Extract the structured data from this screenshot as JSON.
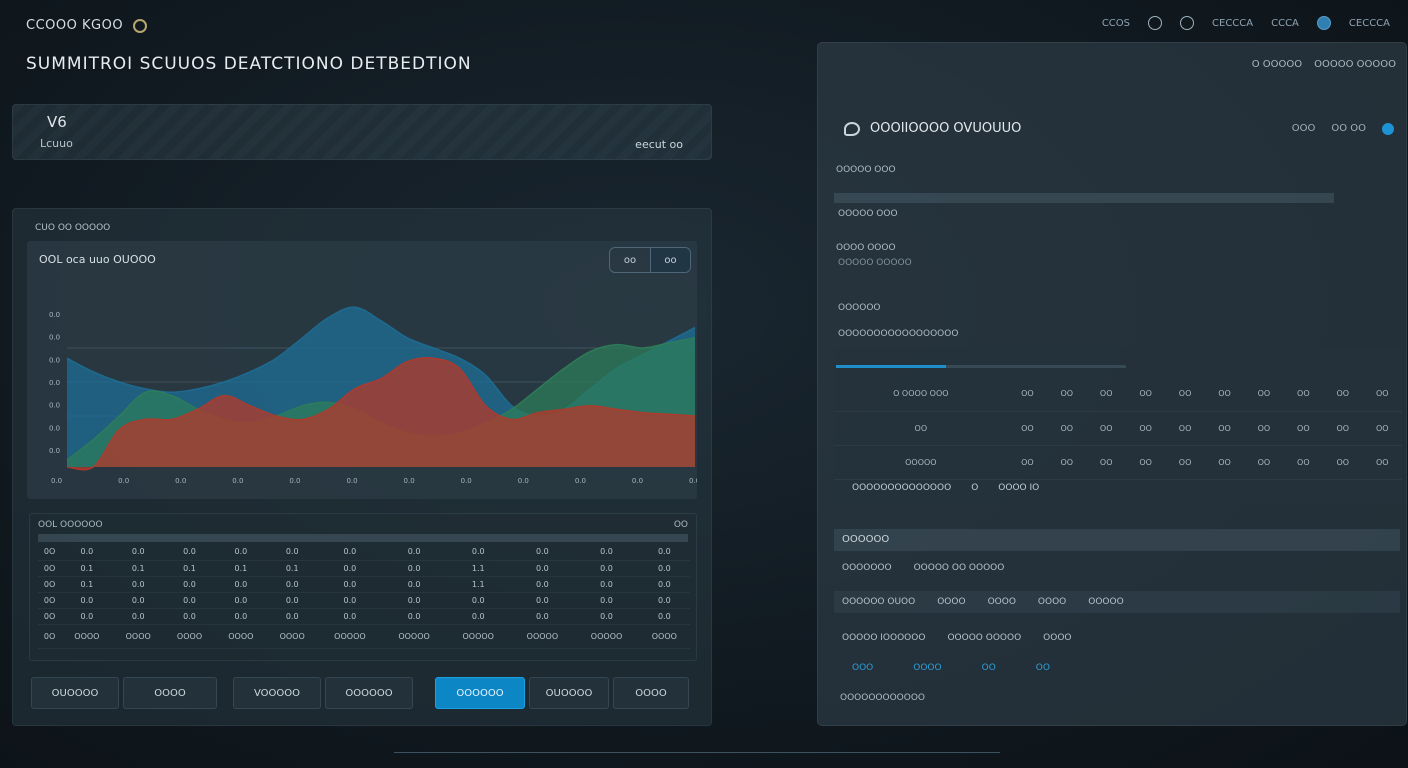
{
  "header": {
    "brand": "CCOOO KGOO",
    "page_title": "SUMMITROI SCUUOS DEATCTIONO DETBEDTION",
    "top_nav": [
      "CCOS",
      "OO",
      "OO",
      "CECCCA",
      "CCCA",
      "OO",
      "CECCCA"
    ]
  },
  "summary_card": {
    "value": "V6",
    "label": "Lcuuo",
    "right_text": "eecut oo"
  },
  "chart_panel": {
    "section_label": "CUO OO OOOOO",
    "chart_title": "OOL oca uuo OUOOO",
    "toggle": [
      "oo",
      "oo"
    ],
    "table_header_left": "OOL OOOOOO",
    "table_header_right": "OO",
    "buttons": [
      "OUOOOO",
      "OOOO",
      "VOOOOO",
      "OOOOOO",
      "OOOOOO",
      "OUOOOO",
      "OOOO"
    ]
  },
  "chart_data": {
    "type": "area",
    "title": "OOL oca uuo OUOOO",
    "y_ticks": [
      "0.0",
      "0.0",
      "0.0",
      "0.0",
      "0.0",
      "0.0",
      "0.0"
    ],
    "x_ticks": [
      "0.0",
      "0.0",
      "0.0",
      "0.0",
      "0.0",
      "0.0",
      "0.0",
      "0.0",
      "0.0",
      "0.0",
      "0.0",
      "0.0"
    ],
    "x": [
      0,
      1,
      2,
      3,
      4,
      5,
      6,
      7,
      8,
      9,
      10,
      11,
      12,
      13,
      14,
      15,
      16,
      17,
      18,
      19,
      20,
      21,
      22,
      23,
      24
    ],
    "ylim": [
      0,
      10
    ],
    "series": [
      {
        "color": "#1d6e96",
        "values": [
          6.4,
          5.6,
          5.0,
          4.6,
          4.4,
          4.6,
          5.0,
          5.6,
          6.4,
          7.6,
          8.8,
          9.4,
          8.6,
          7.6,
          7.0,
          6.4,
          5.4,
          3.6,
          3.0,
          3.4,
          4.6,
          5.8,
          6.6,
          7.4,
          8.2
        ]
      },
      {
        "color": "#2d7e5a",
        "values": [
          0.4,
          1.6,
          3.0,
          4.4,
          4.2,
          3.4,
          2.8,
          2.6,
          3.0,
          3.6,
          3.8,
          3.4,
          2.6,
          2.0,
          1.8,
          2.0,
          2.6,
          3.4,
          4.6,
          5.8,
          6.8,
          7.2,
          7.0,
          7.3,
          7.6
        ]
      },
      {
        "color": "#b03a2c",
        "values": [
          0.0,
          0.0,
          2.2,
          2.8,
          2.8,
          3.4,
          4.2,
          3.6,
          3.0,
          2.8,
          3.4,
          4.6,
          5.2,
          6.2,
          6.4,
          5.8,
          3.6,
          2.8,
          3.2,
          3.4,
          3.6,
          3.4,
          3.2,
          3.1,
          3.0
        ]
      }
    ],
    "grid": true
  },
  "left_table": {
    "rows": [
      [
        "0O",
        "0.0",
        "0.0",
        "0.0",
        "0.0",
        "0.0",
        "0.0",
        "0.0",
        "0.0",
        "0.0",
        "0.0",
        "0.0"
      ],
      [
        "0O",
        "0.1",
        "0.1",
        "0.1",
        "0.1",
        "0.1",
        "0.0",
        "0.0",
        "1.1",
        "0.0",
        "0.0",
        "0.0"
      ],
      [
        "0O",
        "0.1",
        "0.0",
        "0.0",
        "0.0",
        "0.0",
        "0.0",
        "0.0",
        "1.1",
        "0.0",
        "0.0",
        "0.0"
      ],
      [
        "0O",
        "0.0",
        "0.0",
        "0.0",
        "0.0",
        "0.0",
        "0.0",
        "0.0",
        "0.0",
        "0.0",
        "0.0",
        "0.0"
      ],
      [
        "0O",
        "0.0",
        "0.0",
        "0.0",
        "0.0",
        "0.0",
        "0.0",
        "0.0",
        "0.0",
        "0.0",
        "0.0",
        "0.0"
      ],
      [
        "0O",
        "OOOO",
        "OOOO",
        "OOOO",
        "OOOO",
        "OOOO",
        "OOOOO",
        "OOOOO",
        "OOOOO",
        "OOOOO",
        "OOOOO",
        "OOOO"
      ]
    ]
  },
  "right_panel": {
    "top_links": [
      "O OOOOO",
      "OOOOO OOOOO"
    ],
    "title": "OOOIIOOOO OVUOUUO",
    "header_links": [
      "OOO",
      "OO OO"
    ],
    "label1": "OOOOO OOO",
    "label2": "OOOOO OOO",
    "label3": "OOOO OOOO",
    "label3_sub": "OOOOO OOOOO",
    "label4": "OOOOOO",
    "label5": "OOOOOOOOOOOOOOOOO",
    "grid_rows": [
      [
        "O OOOO OOO",
        "OO",
        "OO",
        "OO",
        "OO",
        "OO",
        "OO",
        "OO",
        "OO",
        "OO",
        "OO"
      ],
      [
        "OO",
        "OO",
        "OO",
        "OO",
        "OO",
        "OO",
        "OO",
        "OO",
        "OO",
        "OO",
        "OO"
      ],
      [
        "OOOOO",
        "OO",
        "OO",
        "OO",
        "OO",
        "OO",
        "OO",
        "OO",
        "OO",
        "OO",
        "OO"
      ]
    ],
    "footer_text": [
      "OOOOOOOOOOOOOO",
      "O",
      "OOOO IO"
    ],
    "section_title": "OOOOOO",
    "row1": [
      "OOOOOOO",
      "OOOOO OO OOOOO"
    ],
    "row2": [
      "OOOOOO OUOO",
      "OOOO",
      "OOOO",
      "OOOO",
      "OOOOO"
    ],
    "row3": [
      "OOOOO IOOOOOO",
      "OOOOO OOOOO",
      "OOOO"
    ],
    "row4": [
      "OOO",
      "OOOO",
      "OO",
      "OO"
    ],
    "footer_label": "OOOOOOOOOOOO"
  }
}
